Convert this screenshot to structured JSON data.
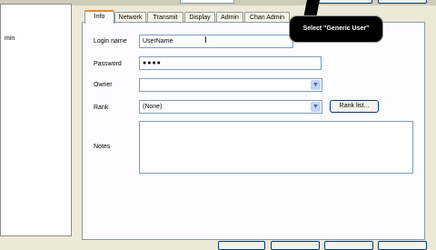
{
  "left_panel": {
    "item_fragment": "min"
  },
  "tabs": [
    "Info",
    "Network",
    "Transmit",
    "Display",
    "Admin",
    "Chan Admin"
  ],
  "form": {
    "login_name_label": "Login name",
    "login_name_value": "UserName",
    "password_label": "Password",
    "password_value": "●●●●",
    "owner_label": "Owner",
    "owner_value": "",
    "rank_label": "Rank",
    "rank_value": "(None)",
    "rank_list_button": "Rank list...",
    "notes_label": "Notes",
    "notes_value": ""
  },
  "callout": {
    "text": "Select \"Generic User\""
  },
  "icons": {
    "dropdown": "chevron-down-icon",
    "cursor": "text-cursor-icon"
  }
}
